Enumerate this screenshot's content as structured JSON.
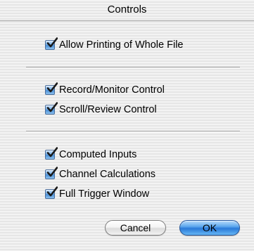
{
  "dialog": {
    "title": "Controls"
  },
  "options": {
    "print": [
      {
        "label": "Allow Printing of Whole File",
        "checked": true
      }
    ],
    "controls": [
      {
        "label": "Record/Monitor Control",
        "checked": true
      },
      {
        "label": "Scroll/Review Control",
        "checked": true
      }
    ],
    "display": [
      {
        "label": "Computed Inputs",
        "checked": true
      },
      {
        "label": "Channel Calculations",
        "checked": true
      },
      {
        "label": "Full Trigger Window",
        "checked": true
      }
    ]
  },
  "buttons": {
    "cancel_label": "Cancel",
    "ok_label": "OK"
  },
  "colors": {
    "accent": "#2a7ad9",
    "checkmark": "#1a1a1a",
    "background": "#ececec"
  }
}
